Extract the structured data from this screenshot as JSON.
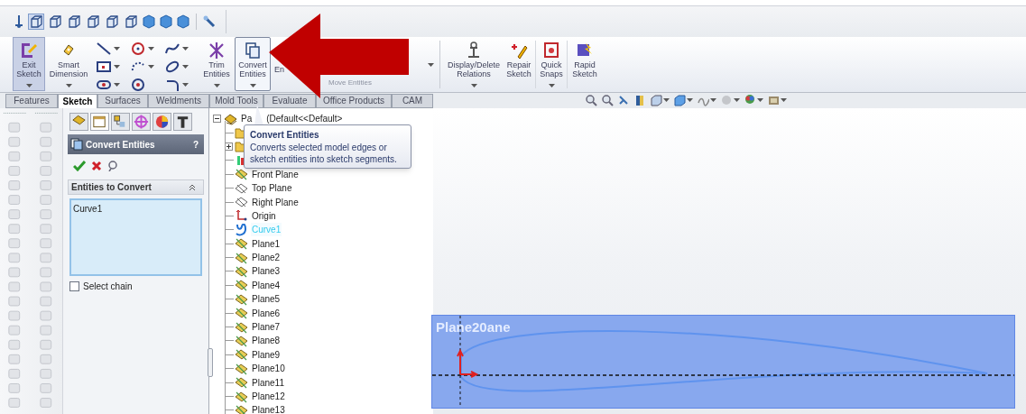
{
  "ribbon": {
    "left": [
      {
        "label": "Exit Sketch",
        "pressed": true,
        "hovered": false,
        "menu": true
      },
      {
        "label": "Smart Dimension",
        "pressed": false,
        "hovered": false,
        "menu": true
      },
      {
        "label": "Trim Entities",
        "pressed": false,
        "hovered": false,
        "menu": true
      },
      {
        "label": "Convert Entities",
        "pressed": false,
        "hovered": true,
        "menu": true
      }
    ],
    "partial": {
      "label": "En",
      "faded_label": "Move Entities"
    },
    "right": [
      {
        "label": "Display/Delete Relations",
        "pressed": false,
        "hovered": false,
        "menu": true
      },
      {
        "label": "Repair Sketch",
        "pressed": false,
        "hovered": false,
        "menu": false
      },
      {
        "label": "Quick Snaps",
        "pressed": false,
        "hovered": false,
        "menu": true
      },
      {
        "label": "Rapid Sketch",
        "pressed": false,
        "hovered": false,
        "menu": false
      }
    ]
  },
  "tabs": [
    {
      "label": "Features",
      "selected": false
    },
    {
      "label": "Sketch",
      "selected": true
    },
    {
      "label": "Surfaces",
      "selected": false
    },
    {
      "label": "Weldments",
      "selected": false
    },
    {
      "label": "Mold Tools",
      "selected": false
    },
    {
      "label": "Evaluate",
      "selected": false
    },
    {
      "label": "Office Products",
      "selected": false
    },
    {
      "label": "CAM",
      "selected": false
    }
  ],
  "property_manager": {
    "title": "Convert Entities",
    "help": "?",
    "section": {
      "title": "Entities to Convert",
      "expanded": true
    },
    "selections": [
      "Curve1"
    ],
    "options": [
      {
        "label": "Select chain",
        "checked": false
      }
    ]
  },
  "tree": {
    "root": [
      "Pa",
      "(Default<<Default>"
    ],
    "items": [
      {
        "kind": "folder",
        "has_children": false,
        "selected": false
      },
      {
        "kind": "folder",
        "has_children": true,
        "selected": false
      },
      {
        "kind": "material",
        "has_children": false,
        "selected": false
      },
      {
        "kind": "plane",
        "label": "Front Plane",
        "has_children": false,
        "selected": false
      },
      {
        "kind": "plane_std",
        "label": "Top Plane",
        "has_children": false,
        "selected": false
      },
      {
        "kind": "plane_std",
        "label": "Right Plane",
        "has_children": false,
        "selected": false
      },
      {
        "kind": "origin",
        "label": "Origin",
        "has_children": false,
        "selected": false
      },
      {
        "kind": "curve",
        "label": "Curve1",
        "has_children": false,
        "selected": true
      },
      {
        "kind": "plane",
        "label": "Plane1",
        "has_children": false,
        "selected": false
      },
      {
        "kind": "plane",
        "label": "Plane2",
        "has_children": false,
        "selected": false
      },
      {
        "kind": "plane",
        "label": "Plane3",
        "has_children": false,
        "selected": false
      },
      {
        "kind": "plane",
        "label": "Plane4",
        "has_children": false,
        "selected": false
      },
      {
        "kind": "plane",
        "label": "Plane5",
        "has_children": false,
        "selected": false
      },
      {
        "kind": "plane",
        "label": "Plane6",
        "has_children": false,
        "selected": false
      },
      {
        "kind": "plane",
        "label": "Plane7",
        "has_children": false,
        "selected": false
      },
      {
        "kind": "plane",
        "label": "Plane8",
        "has_children": false,
        "selected": false
      },
      {
        "kind": "plane",
        "label": "Plane9",
        "has_children": false,
        "selected": false
      },
      {
        "kind": "plane",
        "label": "Plane10",
        "has_children": false,
        "selected": false
      },
      {
        "kind": "plane",
        "label": "Plane11",
        "has_children": false,
        "selected": false
      },
      {
        "kind": "plane",
        "label": "Plane12",
        "has_children": false,
        "selected": false
      },
      {
        "kind": "plane",
        "label": "Plane13",
        "has_children": false,
        "selected": false
      }
    ]
  },
  "tooltip": {
    "title": "Convert Entities",
    "text": "Converts selected model edges or sketch entities into sketch segments."
  },
  "viewport": {
    "plane_label": "Plane20ane"
  }
}
